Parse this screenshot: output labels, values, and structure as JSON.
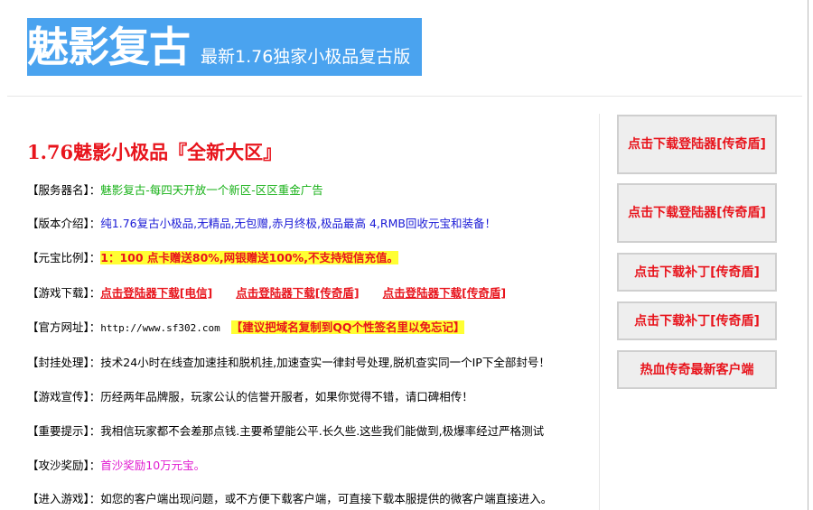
{
  "banner": {
    "title": "魅影复古",
    "subtitle": "最新1.76独家小极品复古版"
  },
  "main": {
    "heading": "1.76魅影小极品『全新大区』",
    "rows": [
      {
        "label": "【服务器名】：",
        "value": "魅影复古-每四天开放一个新区-区区重金广告"
      },
      {
        "label": "【版本介绍】：",
        "value": "纯1.76复古小极品,无精品,无包赠,赤月终极,极品最高 4,RMB回收元宝和装备！"
      },
      {
        "label": "【元宝比例】：",
        "value": "1：100  点卡赠送80%,网银赠送100%,不支持短信充值。"
      },
      {
        "label": "【游戏下载】：",
        "links": [
          "点击登陆器下载[电信]",
          "点击登陆器下载[传奇盾]",
          "点击登陆器下载[传奇盾]"
        ]
      },
      {
        "label": "【官方网址】：",
        "url": "http://www.sf302.com",
        "note": "【建议把域名复制到QQ个性签名里以免忘记】"
      },
      {
        "label": "【封挂处理】：",
        "value": "技术24小时在线查加速挂和脱机挂,加速查实一律封号处理,脱机查实同一个IP下全部封号！"
      },
      {
        "label": "【游戏宣传】：",
        "value": "历经两年品牌服，玩家公认的信誉开服者，如果你觉得不错，请口碑相传！"
      },
      {
        "label": "【重要提示】：",
        "value": "我相信玩家都不会差那点钱.主要希望能公平.长久些.这些我们能做到,极爆率经过严格测试"
      },
      {
        "label": "【攻沙奖励】：",
        "value": "首沙奖励10万元宝。"
      },
      {
        "label": "【进入游戏】：",
        "value": "如您的客户端出现问题，或不方便下载客户端，可直接下载本服提供的微客户端直接进入。"
      }
    ]
  },
  "sidebar": {
    "buttons": [
      "点击下载登陆器[传奇盾]",
      "点击下载登陆器[传奇盾]",
      "点击下载补丁[传奇盾]",
      "点击下载补丁[传奇盾]",
      "热血传奇最新客户端"
    ]
  },
  "colors": {
    "banner_bg": "#4aa3ef",
    "accent_red": "#e8141c",
    "green": "#19b219",
    "blue": "#1a1ad6",
    "magenta": "#e01ad0",
    "highlight": "#ffff33"
  }
}
